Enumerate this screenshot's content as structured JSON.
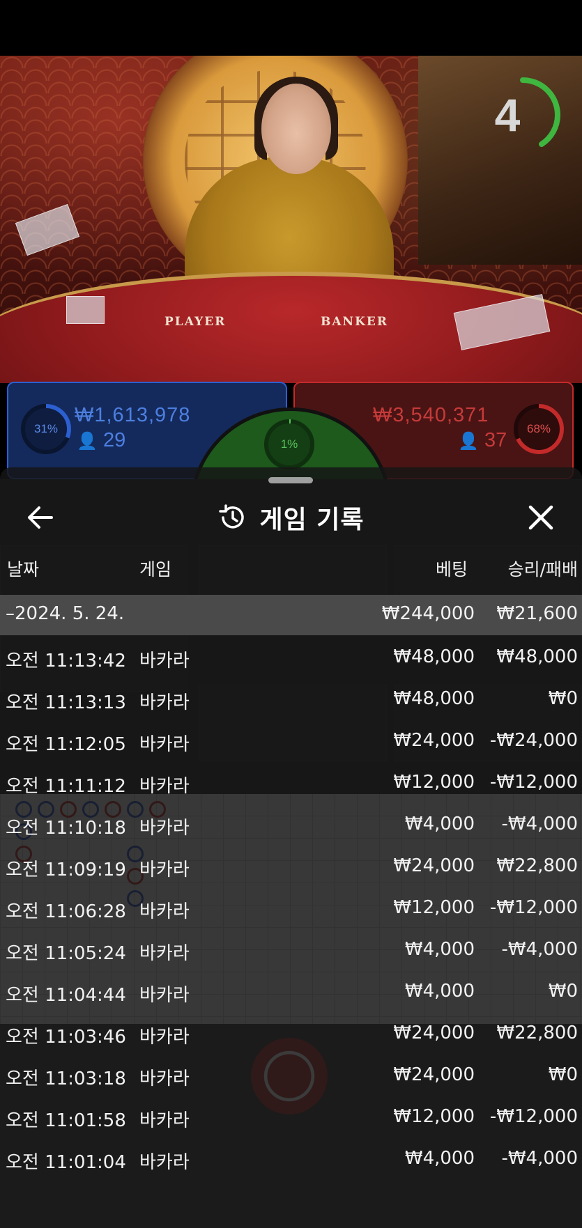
{
  "stream": {
    "table_labels": {
      "player": "PLAYER",
      "banker": "BANKER"
    },
    "countdown": "4"
  },
  "betting": {
    "player": {
      "percent": "31%",
      "amount": "₩1,613,978",
      "players": "29",
      "percent_value": 0.31
    },
    "banker": {
      "percent": "68%",
      "amount": "₩3,540,371",
      "players": "37",
      "percent_value": 0.68
    },
    "tie": {
      "percent": "1%",
      "percent_value": 0.01
    }
  },
  "sheet": {
    "title": "게임 기록",
    "icons": {
      "back": "arrow-left-icon",
      "history": "history-icon",
      "close": "close-icon"
    },
    "headers": {
      "date": "날짜",
      "game": "게임",
      "bet": "베팅",
      "result": "승리/패배"
    },
    "summary": {
      "date": "–2024. 5. 24.",
      "bet": "₩244,000",
      "result": "₩21,600"
    },
    "rows": [
      {
        "time": "오전 11:13:42",
        "game": "바카라",
        "bet": "₩48,000",
        "result": "₩48,000"
      },
      {
        "time": "오전 11:13:13",
        "game": "바카라",
        "bet": "₩48,000",
        "result": "₩0"
      },
      {
        "time": "오전 11:12:05",
        "game": "바카라",
        "bet": "₩24,000",
        "result": "-₩24,000"
      },
      {
        "time": "오전 11:11:12",
        "game": "바카라",
        "bet": "₩12,000",
        "result": "-₩12,000"
      },
      {
        "time": "오전 11:10:18",
        "game": "바카라",
        "bet": "₩4,000",
        "result": "-₩4,000"
      },
      {
        "time": "오전 11:09:19",
        "game": "바카라",
        "bet": "₩24,000",
        "result": "₩22,800"
      },
      {
        "time": "오전 11:06:28",
        "game": "바카라",
        "bet": "₩12,000",
        "result": "-₩12,000"
      },
      {
        "time": "오전 11:05:24",
        "game": "바카라",
        "bet": "₩4,000",
        "result": "-₩4,000"
      },
      {
        "time": "오전 11:04:44",
        "game": "바카라",
        "bet": "₩4,000",
        "result": "₩0"
      },
      {
        "time": "오전 11:03:46",
        "game": "바카라",
        "bet": "₩24,000",
        "result": "₩22,800"
      },
      {
        "time": "오전 11:03:18",
        "game": "바카라",
        "bet": "₩24,000",
        "result": "₩0"
      },
      {
        "time": "오전 11:01:58",
        "game": "바카라",
        "bet": "₩12,000",
        "result": "-₩12,000"
      },
      {
        "time": "오전 11:01:04",
        "game": "바카라",
        "bet": "₩4,000",
        "result": "-₩4,000"
      }
    ]
  },
  "colors": {
    "player_blue": "#2c5fd0",
    "banker_red": "#c42a2a",
    "tie_green": "#58c25a",
    "timer_green": "#3fb63f"
  }
}
